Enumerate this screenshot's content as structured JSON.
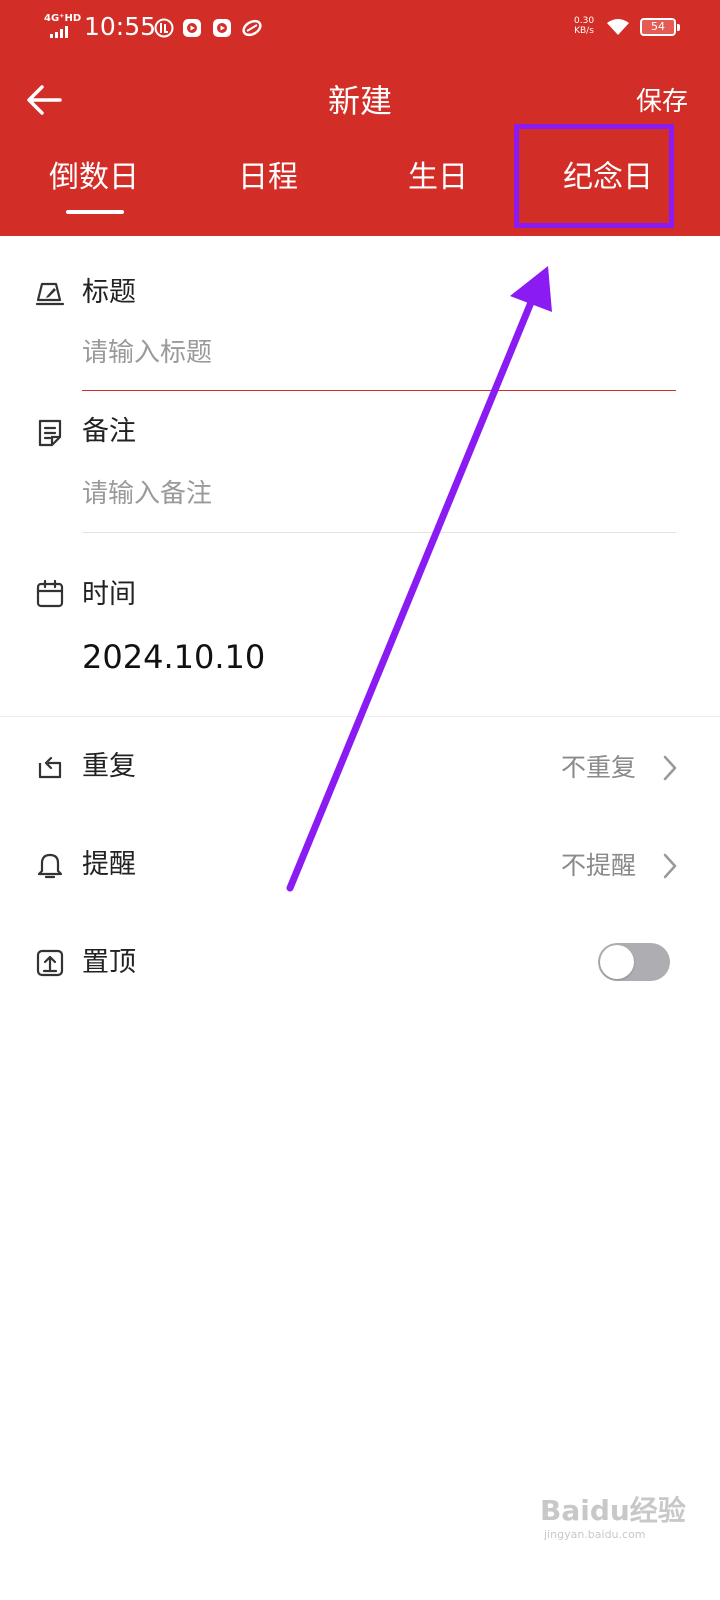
{
  "status_bar": {
    "network": "4G⁺HD",
    "time": "10:55",
    "net_speed_value": "0.30",
    "net_speed_unit": "KB/s",
    "battery": "54"
  },
  "header": {
    "title": "新建",
    "save_label": "保存",
    "background_color": "#d22d27",
    "tabs": [
      {
        "label": "倒数日",
        "selected": true
      },
      {
        "label": "日程",
        "selected": false
      },
      {
        "label": "生日",
        "selected": false
      },
      {
        "label": "纪念日",
        "selected": false
      }
    ]
  },
  "form": {
    "title_field": {
      "label": "标题",
      "placeholder": "请输入标题",
      "value": ""
    },
    "note_field": {
      "label": "备注",
      "placeholder": "请输入备注",
      "value": ""
    },
    "time_field": {
      "label": "时间",
      "value": "2024.10.10"
    }
  },
  "settings": {
    "repeat": {
      "label": "重复",
      "value": "不重复"
    },
    "reminder": {
      "label": "提醒",
      "value": "不提醒"
    },
    "pin": {
      "label": "置顶",
      "enabled": false
    }
  },
  "annotation": {
    "highlight_color": "#8a1bf2"
  },
  "watermark": {
    "main": "Baidu经验",
    "sub": "jingyan.baidu.com"
  }
}
